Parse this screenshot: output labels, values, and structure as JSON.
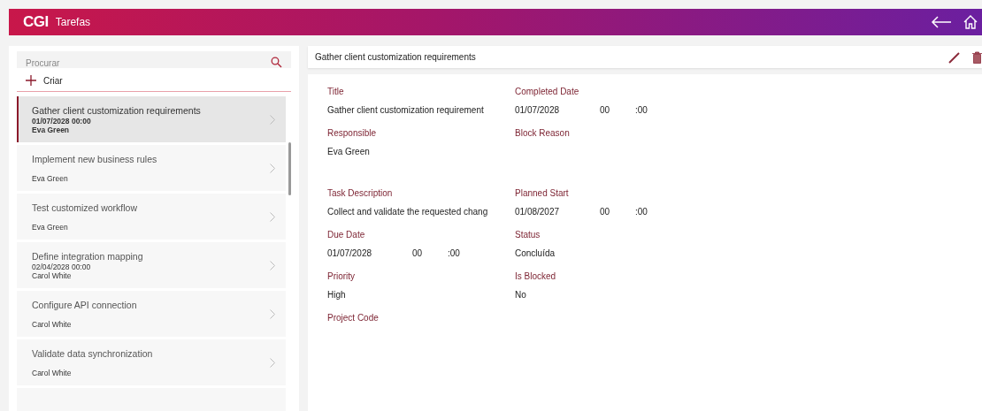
{
  "header": {
    "logo": "CGI",
    "title": "Tarefas"
  },
  "search": {
    "placeholder": "Procurar"
  },
  "create_label": "Criar",
  "tasks": [
    {
      "title": "Gather client customization requirements",
      "date": "01/07/2028 00:00",
      "responsible": "Eva Green",
      "selected": true
    },
    {
      "title": "Implement new business rules",
      "responsible": "Eva Green",
      "selected": false
    },
    {
      "title": "Test customized workflow",
      "responsible": "Eva Green",
      "selected": false
    },
    {
      "title": "Define integration mapping",
      "date": "02/04/2028 00:00",
      "responsible": "Carol White",
      "selected": false
    },
    {
      "title": "Configure API connection",
      "responsible": "Carol White",
      "selected": false
    },
    {
      "title": "Validate data synchronization",
      "responsible": "Carol White",
      "selected": false
    },
    {
      "selected": false
    }
  ],
  "detail": {
    "title": "Gather client customization requirements",
    "fields": [
      {
        "kind": "text",
        "label": "Title",
        "value": "Gather client customization requirement"
      },
      {
        "kind": "datetime",
        "label": "Completed Date",
        "date": "01/07/2028",
        "hour": "00",
        "minute": ":00"
      },
      {
        "kind": "text",
        "label": "Responsible",
        "value": "Eva Green"
      },
      {
        "kind": "multiline",
        "label": "Block Reason"
      },
      {
        "kind": "text",
        "label": "Task Description",
        "value": "Collect and validate the requested chang"
      },
      {
        "kind": "datetime",
        "label": "Planned Start",
        "date": "01/08/2027",
        "hour": "00",
        "minute": ":00"
      },
      {
        "kind": "datetime",
        "label": "Due Date",
        "date": "01/07/2028",
        "hour": "00",
        "minute": ":00"
      },
      {
        "kind": "text",
        "label": "Status",
        "value": "Concluída"
      },
      {
        "kind": "text",
        "label": "Priority",
        "value": "High"
      },
      {
        "kind": "text",
        "label": "Is Blocked",
        "value": "No"
      },
      {
        "kind": "text",
        "label": "Project Code"
      }
    ]
  }
}
